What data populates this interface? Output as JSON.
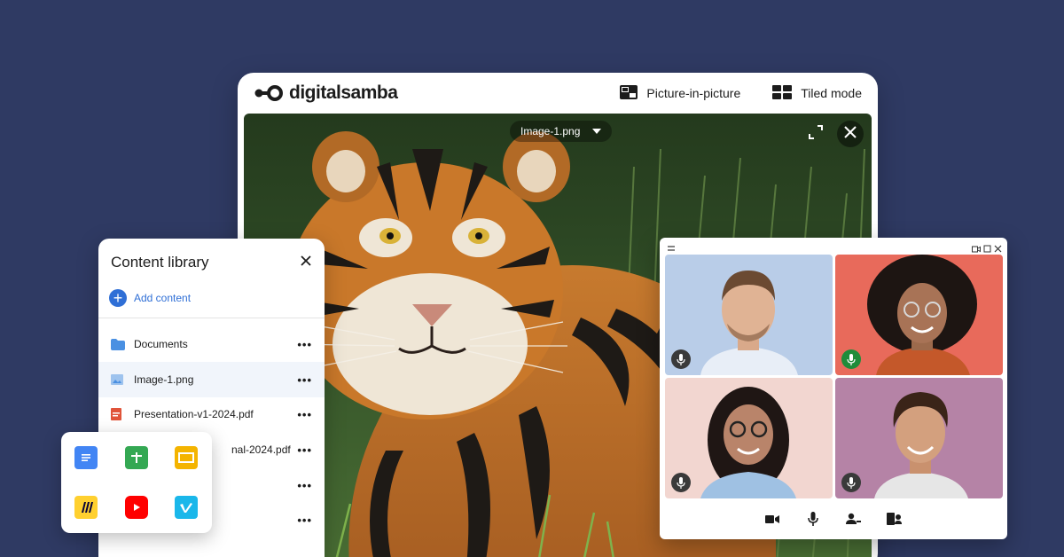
{
  "brand": {
    "name": "digitalsamba",
    "icon": "logo-mark-icon"
  },
  "header": {
    "pip_label": "Picture-in-picture",
    "pip_icon": "picture-in-picture-icon",
    "tiled_label": "Tiled mode",
    "tiled_icon": "tiled-mode-icon"
  },
  "stage": {
    "file_name": "Image-1.png",
    "file_dropdown_icon": "chevron-down-icon",
    "fullscreen_icon": "fullscreen-icon",
    "close_icon": "close-icon"
  },
  "library": {
    "title": "Content library",
    "add_label": "Add content",
    "items": [
      {
        "label": "Documents",
        "icon": "folder-icon",
        "more": "•••"
      },
      {
        "label": "Image-1.png",
        "icon": "image-icon",
        "more": "•••"
      },
      {
        "label": "Presentation-v1-2024.pdf",
        "icon": "pdf-icon",
        "more": "•••"
      },
      {
        "label": "nal-2024.pdf",
        "icon": "pdf-icon",
        "more": "•••"
      },
      {
        "label": "",
        "icon": "",
        "more": "•••"
      },
      {
        "label": "",
        "icon": "",
        "more": "•••"
      }
    ]
  },
  "apps": [
    {
      "name": "google-docs-icon",
      "color": "#4285f4"
    },
    {
      "name": "google-sheets-icon",
      "color": "#34a853"
    },
    {
      "name": "google-slides-icon",
      "color": "#f4b400"
    },
    {
      "name": "miro-icon",
      "color": "#ffd02f"
    },
    {
      "name": "youtube-icon",
      "color": "#ff0000"
    },
    {
      "name": "vimeo-icon",
      "color": "#1ab7ea"
    }
  ],
  "call": {
    "participants": [
      {
        "name": "participant-1",
        "bg": "#b9cde8",
        "mic": "muted"
      },
      {
        "name": "participant-2",
        "bg": "#e86a5b",
        "mic": "active"
      },
      {
        "name": "participant-3",
        "bg": "#f2d6d0",
        "mic": "muted"
      },
      {
        "name": "participant-4",
        "bg": "#b583a6",
        "mic": "muted"
      }
    ],
    "controls": [
      "camera-icon",
      "microphone-icon",
      "participants-icon",
      "share-screen-icon"
    ]
  },
  "colors": {
    "background": "#2f3a63",
    "accent": "#2f6fd6"
  }
}
